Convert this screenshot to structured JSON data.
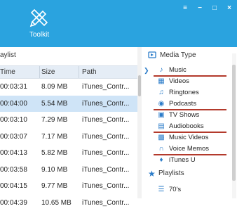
{
  "toolkit": {
    "label": "Toolkit"
  },
  "window_controls": {
    "menu": "≡",
    "minimize": "−",
    "maximize": "□",
    "close": "×"
  },
  "left": {
    "title": "aylist",
    "columns": {
      "time": "Time",
      "size": "Size",
      "path": "Path"
    },
    "rows": [
      {
        "time": "00:03:31",
        "size": "8.09 MB",
        "path": "iTunes_Contr..."
      },
      {
        "time": "00:04:00",
        "size": "5.54 MB",
        "path": "iTunes_Contr..."
      },
      {
        "time": "00:03:10",
        "size": "7.29 MB",
        "path": "iTunes_Contr..."
      },
      {
        "time": "00:03:07",
        "size": "7.17 MB",
        "path": "iTunes_Contr..."
      },
      {
        "time": "00:04:13",
        "size": "5.82 MB",
        "path": "iTunes_Contr..."
      },
      {
        "time": "00:03:58",
        "size": "9.10 MB",
        "path": "iTunes_Contr..."
      },
      {
        "time": "00:04:15",
        "size": "9.77 MB",
        "path": "iTunes_Contr..."
      },
      {
        "time": "00:04:39",
        "size": "10.65 MB",
        "path": "iTunes_Contr..."
      }
    ]
  },
  "right": {
    "media_type_label": "Media Type",
    "items": [
      {
        "label": "Music",
        "icon": "music-note-icon"
      },
      {
        "label": "Videos",
        "icon": "video-icon"
      },
      {
        "label": "Ringtones",
        "icon": "bell-icon"
      },
      {
        "label": "Podcasts",
        "icon": "podcast-icon"
      },
      {
        "label": "TV Shows",
        "icon": "tv-icon"
      },
      {
        "label": "Audiobooks",
        "icon": "book-icon"
      },
      {
        "label": "Music Videos",
        "icon": "music-video-icon"
      },
      {
        "label": "Voice Memos",
        "icon": "headset-icon"
      },
      {
        "label": "iTunes U",
        "icon": "graduation-cap-icon"
      }
    ],
    "playlists_label": "Playlists",
    "playlists": [
      {
        "label": "70's",
        "icon": "playlist-icon"
      }
    ]
  }
}
